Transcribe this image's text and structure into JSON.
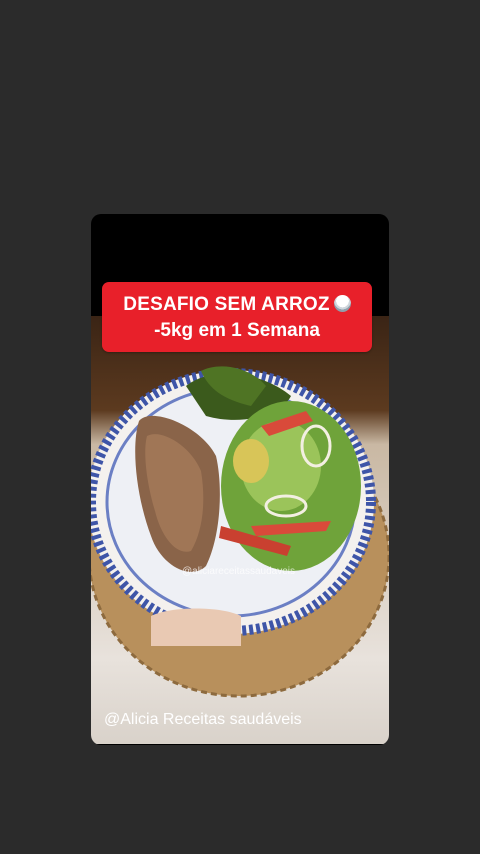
{
  "story": {
    "banner_line1": "DESAFIO SEM ARROZ",
    "banner_line2": "-5kg em 1 Semana",
    "bowl_icon": "rice-bowl-icon",
    "watermark": "@aliciareceitassaudaveis",
    "credit": "@Alicia Receitas saudáveis"
  },
  "colors": {
    "background": "#2b2b2b",
    "card": "#000000",
    "banner": "#e8202a",
    "text": "#ffffff"
  }
}
